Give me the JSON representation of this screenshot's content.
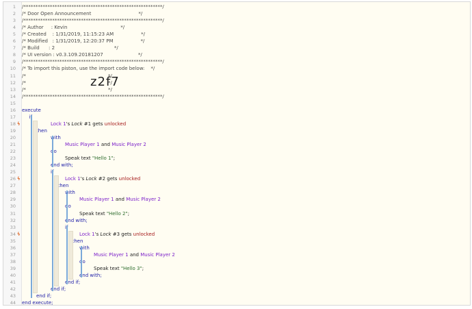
{
  "lines": [
    {
      "n": "1",
      "indent": 0,
      "parts": [
        {
          "t": "/**********************************************************/",
          "c": "comment"
        }
      ]
    },
    {
      "n": "2",
      "indent": 0,
      "parts": [
        {
          "t": "/* Door Open Announcement                               */",
          "c": "comment"
        }
      ]
    },
    {
      "n": "3",
      "indent": 0,
      "parts": [
        {
          "t": "/**********************************************************/",
          "c": "comment"
        }
      ]
    },
    {
      "n": "4",
      "indent": 0,
      "parts": [
        {
          "t": "/* Author     : Kevin                                   */",
          "c": "comment"
        }
      ]
    },
    {
      "n": "5",
      "indent": 0,
      "parts": [
        {
          "t": "/* Created    : 1/31/2019, 11:15:23 AM                  */",
          "c": "comment"
        }
      ]
    },
    {
      "n": "6",
      "indent": 0,
      "parts": [
        {
          "t": "/* Modified   : 1/31/2019, 12:20:37 PM                  */",
          "c": "comment"
        }
      ]
    },
    {
      "n": "7",
      "indent": 0,
      "parts": [
        {
          "t": "/* Build      : 2                                       */",
          "c": "comment"
        }
      ]
    },
    {
      "n": "8",
      "indent": 0,
      "parts": [
        {
          "t": "/* UI version : v0.3.109.20181207                       */",
          "c": "comment"
        }
      ]
    },
    {
      "n": "9",
      "indent": 0,
      "parts": [
        {
          "t": "/**********************************************************/",
          "c": "comment"
        }
      ]
    },
    {
      "n": "10",
      "indent": 0,
      "parts": [
        {
          "t": "/* To import this piston, use the import code below:    */",
          "c": "comment"
        }
      ]
    },
    {
      "n": "11",
      "indent": 0,
      "parts": [
        {
          "t": "/*                                                      */",
          "c": "comment"
        }
      ]
    },
    {
      "n": "12",
      "indent": 0,
      "parts": [
        {
          "t": "/*                                                      */",
          "c": "comment"
        }
      ]
    },
    {
      "n": "13",
      "indent": 0,
      "parts": [
        {
          "t": "/*                                                      */",
          "c": "comment"
        }
      ]
    },
    {
      "n": "14",
      "indent": 0,
      "parts": [
        {
          "t": "/**********************************************************/",
          "c": "comment"
        }
      ]
    },
    {
      "n": "15",
      "indent": 0,
      "parts": []
    },
    {
      "n": "16",
      "indent": 0,
      "parts": [
        {
          "t": "execute",
          "c": "kw"
        }
      ]
    },
    {
      "n": "17",
      "indent": 1,
      "parts": [
        {
          "t": "if",
          "c": "kw"
        }
      ]
    },
    {
      "n": "18",
      "indent": 4,
      "marker": true,
      "parts": [
        {
          "t": "Lock 1",
          "c": "dev"
        },
        {
          "t": "'s ",
          "c": "txt"
        },
        {
          "t": "Lock",
          "c": "txt it"
        },
        {
          "t": " #1 gets ",
          "c": "txt"
        },
        {
          "t": "unlocked",
          "c": "red"
        }
      ]
    },
    {
      "n": "19",
      "indent": 2,
      "parts": [
        {
          "t": "then",
          "c": "kw"
        }
      ]
    },
    {
      "n": "20",
      "indent": 4,
      "parts": [
        {
          "t": "with",
          "c": "kw"
        }
      ]
    },
    {
      "n": "21",
      "indent": 6,
      "parts": [
        {
          "t": "Music Player 1",
          "c": "dev"
        },
        {
          "t": " and ",
          "c": "txt"
        },
        {
          "t": "Music Player 2",
          "c": "dev"
        }
      ]
    },
    {
      "n": "22",
      "indent": 4,
      "parts": [
        {
          "t": "do",
          "c": "kw"
        }
      ]
    },
    {
      "n": "23",
      "indent": 6,
      "parts": [
        {
          "t": "Speak text ",
          "c": "txt"
        },
        {
          "t": "\"Hello 1\"",
          "c": "str"
        },
        {
          "t": ";",
          "c": "txt"
        }
      ]
    },
    {
      "n": "24",
      "indent": 4,
      "parts": [
        {
          "t": "end with;",
          "c": "kw"
        }
      ]
    },
    {
      "n": "25",
      "indent": 4,
      "parts": [
        {
          "t": "if",
          "c": "kw"
        }
      ]
    },
    {
      "n": "26",
      "indent": 6,
      "marker": true,
      "parts": [
        {
          "t": "Lock 1",
          "c": "dev"
        },
        {
          "t": "'s ",
          "c": "txt"
        },
        {
          "t": "Lock",
          "c": "txt it"
        },
        {
          "t": " #2 gets ",
          "c": "txt"
        },
        {
          "t": "unlocked",
          "c": "red"
        }
      ]
    },
    {
      "n": "27",
      "indent": 5,
      "parts": [
        {
          "t": "then",
          "c": "kw"
        }
      ]
    },
    {
      "n": "28",
      "indent": 6,
      "parts": [
        {
          "t": "with",
          "c": "kw"
        }
      ]
    },
    {
      "n": "29",
      "indent": 8,
      "parts": [
        {
          "t": "Music Player 1",
          "c": "dev"
        },
        {
          "t": " and ",
          "c": "txt"
        },
        {
          "t": "Music Player 2",
          "c": "dev"
        }
      ]
    },
    {
      "n": "30",
      "indent": 6,
      "parts": [
        {
          "t": "do",
          "c": "kw"
        }
      ]
    },
    {
      "n": "31",
      "indent": 8,
      "parts": [
        {
          "t": "Speak text ",
          "c": "txt"
        },
        {
          "t": "\"Hello 2\"",
          "c": "str"
        },
        {
          "t": ";",
          "c": "txt"
        }
      ]
    },
    {
      "n": "32",
      "indent": 6,
      "parts": [
        {
          "t": "end with;",
          "c": "kw"
        }
      ]
    },
    {
      "n": "33",
      "indent": 6,
      "parts": [
        {
          "t": "if",
          "c": "kw"
        }
      ]
    },
    {
      "n": "34",
      "indent": 8,
      "marker": true,
      "parts": [
        {
          "t": "Lock 1",
          "c": "dev"
        },
        {
          "t": "'s ",
          "c": "txt"
        },
        {
          "t": "Lock",
          "c": "txt it"
        },
        {
          "t": " #3 gets ",
          "c": "txt"
        },
        {
          "t": "unlocked",
          "c": "red"
        }
      ]
    },
    {
      "n": "35",
      "indent": 7,
      "parts": [
        {
          "t": "then",
          "c": "kw"
        }
      ]
    },
    {
      "n": "36",
      "indent": 8,
      "parts": [
        {
          "t": "with",
          "c": "kw"
        }
      ]
    },
    {
      "n": "37",
      "indent": 10,
      "parts": [
        {
          "t": "Music Player 1",
          "c": "dev"
        },
        {
          "t": " and ",
          "c": "txt"
        },
        {
          "t": "Music Player 2",
          "c": "dev"
        }
      ]
    },
    {
      "n": "38",
      "indent": 8,
      "parts": [
        {
          "t": "do",
          "c": "kw"
        }
      ]
    },
    {
      "n": "39",
      "indent": 10,
      "parts": [
        {
          "t": "Speak text ",
          "c": "txt"
        },
        {
          "t": "\"Hello 3\"",
          "c": "str"
        },
        {
          "t": ";",
          "c": "txt"
        }
      ]
    },
    {
      "n": "40",
      "indent": 8,
      "parts": [
        {
          "t": "end with;",
          "c": "kw"
        }
      ]
    },
    {
      "n": "41",
      "indent": 6,
      "parts": [
        {
          "t": "end if;",
          "c": "kw"
        }
      ]
    },
    {
      "n": "42",
      "indent": 4,
      "parts": [
        {
          "t": "end if;",
          "c": "kw"
        }
      ]
    },
    {
      "n": "43",
      "indent": 2,
      "parts": [
        {
          "t": "end if;",
          "c": "kw"
        }
      ]
    },
    {
      "n": "44",
      "indent": 0,
      "parts": [
        {
          "t": "end execute;",
          "c": "kw"
        }
      ]
    }
  ],
  "import_code": "z2f7",
  "marker_glyph": "ϟ",
  "colors": {
    "keyword": "#1a1aa6",
    "device": "#7b1fc9",
    "string": "#2b6b2b",
    "state": "#a51a1a",
    "block_bar": "#7aa9d9",
    "marker": "#e06c2c"
  }
}
